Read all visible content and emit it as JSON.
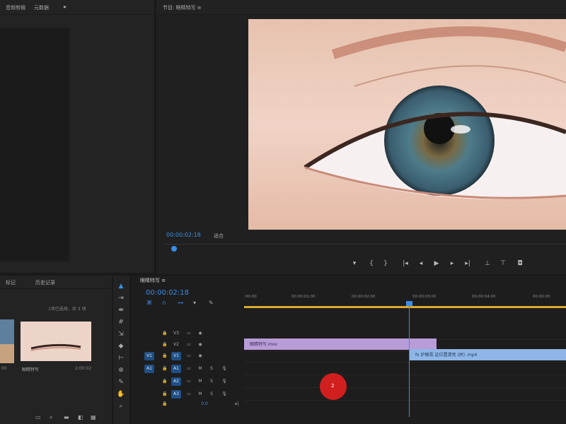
{
  "top_left": {
    "tabs": [
      "音频剪辑",
      "元数据"
    ]
  },
  "program_monitor": {
    "title": "节目: 眼睛特写 ≡",
    "timecode": "00:00:02:18",
    "fit": "适合"
  },
  "project": {
    "tabs": [
      "标记",
      "历史记录"
    ],
    "count": "1项已选择，共 3 项",
    "item_name": "眼睛特写",
    "item_duration": "2:00:02",
    "thumb1_duration": "00"
  },
  "timeline": {
    "sequence_tab": "眼睛特写 ≡",
    "timecode": "00:00:02:18",
    "ruler_labels": [
      ":00:00",
      "00:00:01:00",
      "00:00:02:00",
      "00:00:03:00",
      "00:00:04:00",
      "00:00:05"
    ],
    "tracks": [
      {
        "name": "V3"
      },
      {
        "name": "V2"
      },
      {
        "name": "V1",
        "src": "V1"
      },
      {
        "name": "A1",
        "src": "A1"
      },
      {
        "name": "A2"
      },
      {
        "name": "A3"
      }
    ],
    "master_value": "0.0",
    "clip_v1": "眼睛特写.mov",
    "clip_v2": "fx 护眼膏  这位置清亮 (拼) .mp4"
  },
  "cursor": {
    "label": "2"
  },
  "colors": {
    "accent": "#3a8ee6",
    "clip_video": "#b89cd8",
    "clip_audio": "#8fb6e6",
    "work_area": "#d9a935",
    "click_marker": "#d11f1f"
  }
}
